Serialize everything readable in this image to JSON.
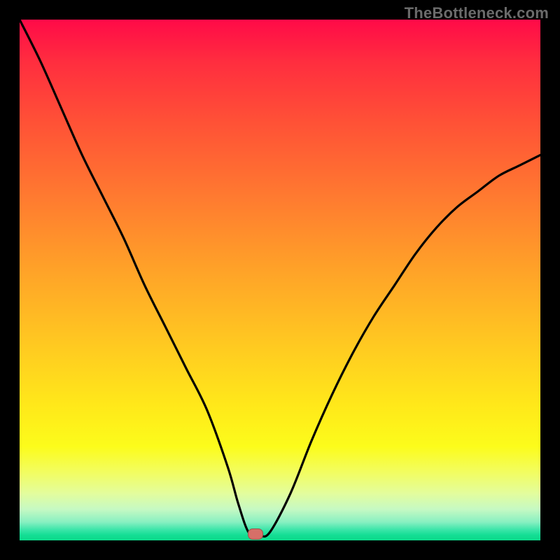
{
  "watermark": "TheBottleneck.com",
  "colors": {
    "frame": "#000000",
    "curve": "#000000",
    "marker": "#d66f68",
    "gradient_top": "#ff0a48",
    "gradient_bottom": "#0cd98a"
  },
  "chart_data": {
    "type": "line",
    "title": "",
    "xlabel": "",
    "ylabel": "",
    "xlim": [
      0,
      100
    ],
    "ylim": [
      0,
      100
    ],
    "grid": false,
    "legend": false,
    "annotations": [
      "TheBottleneck.com"
    ],
    "series": [
      {
        "name": "bottleneck-curve",
        "x": [
          0,
          4,
          8,
          12,
          16,
          20,
          24,
          28,
          32,
          36,
          40,
          42,
          44,
          46,
          48,
          52,
          56,
          60,
          64,
          68,
          72,
          76,
          80,
          84,
          88,
          92,
          96,
          100
        ],
        "y": [
          100,
          92,
          83,
          74,
          66,
          58,
          49,
          41,
          33,
          25,
          14,
          7,
          1.5,
          1,
          1.5,
          9,
          19,
          28,
          36,
          43,
          49,
          55,
          60,
          64,
          67,
          70,
          72,
          74
        ]
      }
    ],
    "flat_bottom": {
      "x_start": 42,
      "x_end": 46,
      "y": 1
    },
    "marker": {
      "x": 45.3,
      "y": 1.2
    }
  }
}
